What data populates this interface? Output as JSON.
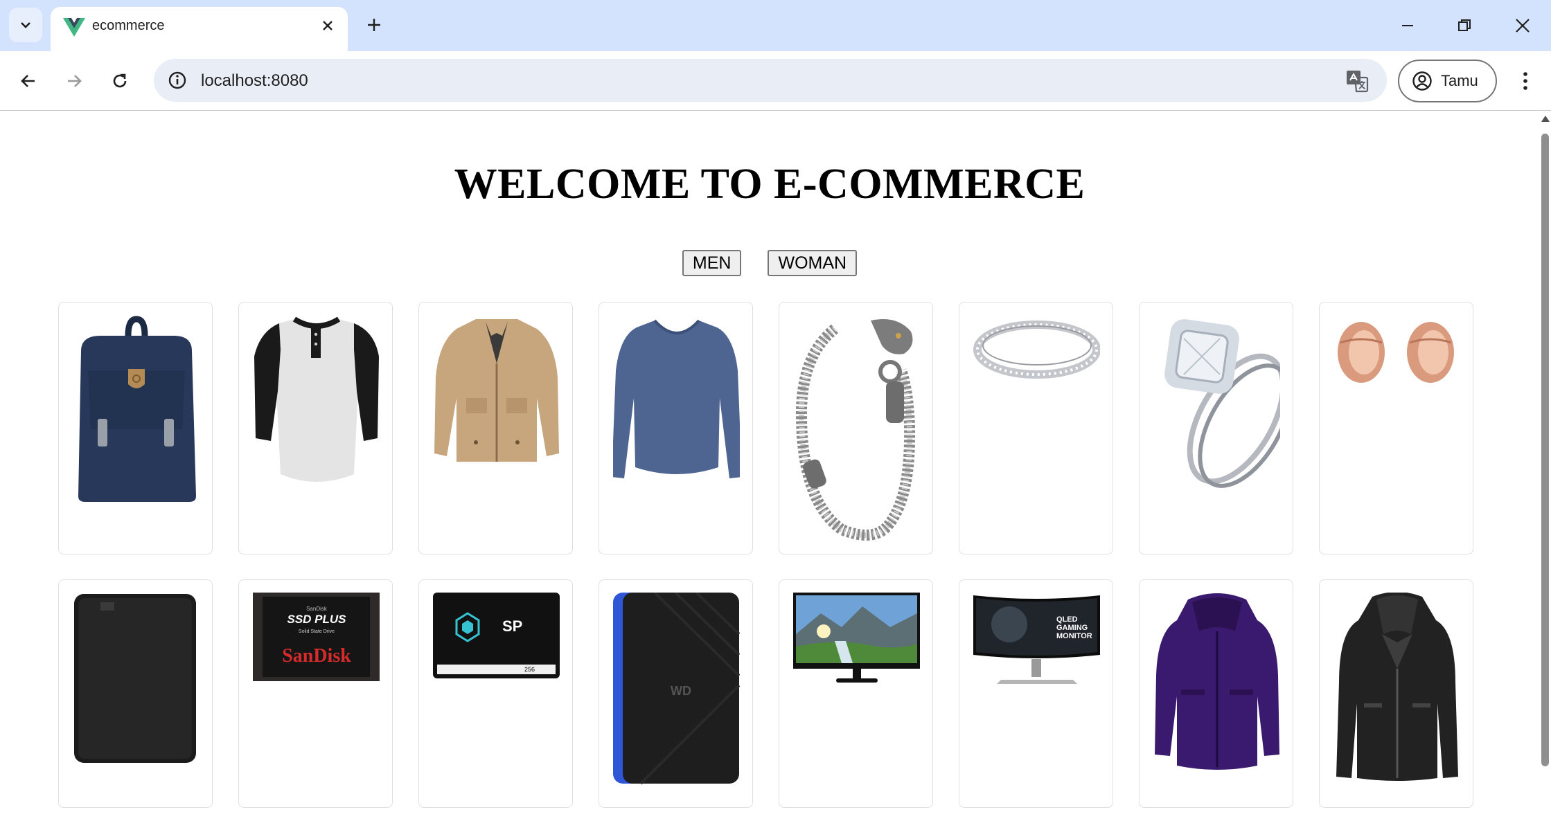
{
  "browser": {
    "tab_title": "ecommerce",
    "url": "localhost:8080",
    "profile_name": "Tamu"
  },
  "page": {
    "title": "WELCOME TO E-COMMERCE",
    "filters": [
      "MEN",
      "WOMAN"
    ]
  },
  "products": [
    {
      "icon": "backpack-product-image"
    },
    {
      "icon": "henley-shirt-product-image"
    },
    {
      "icon": "jacket-product-image"
    },
    {
      "icon": "long-sleeve-shirt-product-image"
    },
    {
      "icon": "dragon-bracelet-product-image"
    },
    {
      "icon": "silver-ring-product-image"
    },
    {
      "icon": "engagement-ring-product-image"
    },
    {
      "icon": "rose-gold-plugs-product-image"
    },
    {
      "icon": "external-hard-drive-product-image"
    },
    {
      "icon": "sandisk-ssd-product-image",
      "print": [
        "SanDisk",
        "SSD PLUS",
        "Solid State Drive",
        "SanDisk"
      ]
    },
    {
      "icon": "sp-ssd-product-image",
      "print": [
        "SP",
        "256"
      ]
    },
    {
      "icon": "wd-portable-drive-product-image",
      "print": [
        "WD"
      ]
    },
    {
      "icon": "monitor-landscape-product-image"
    },
    {
      "icon": "curved-gaming-monitor-product-image",
      "print": [
        "QLED",
        "GAMING",
        "MONITOR"
      ]
    },
    {
      "icon": "purple-womens-jacket-product-image"
    },
    {
      "icon": "black-leather-jacket-product-image"
    }
  ]
}
